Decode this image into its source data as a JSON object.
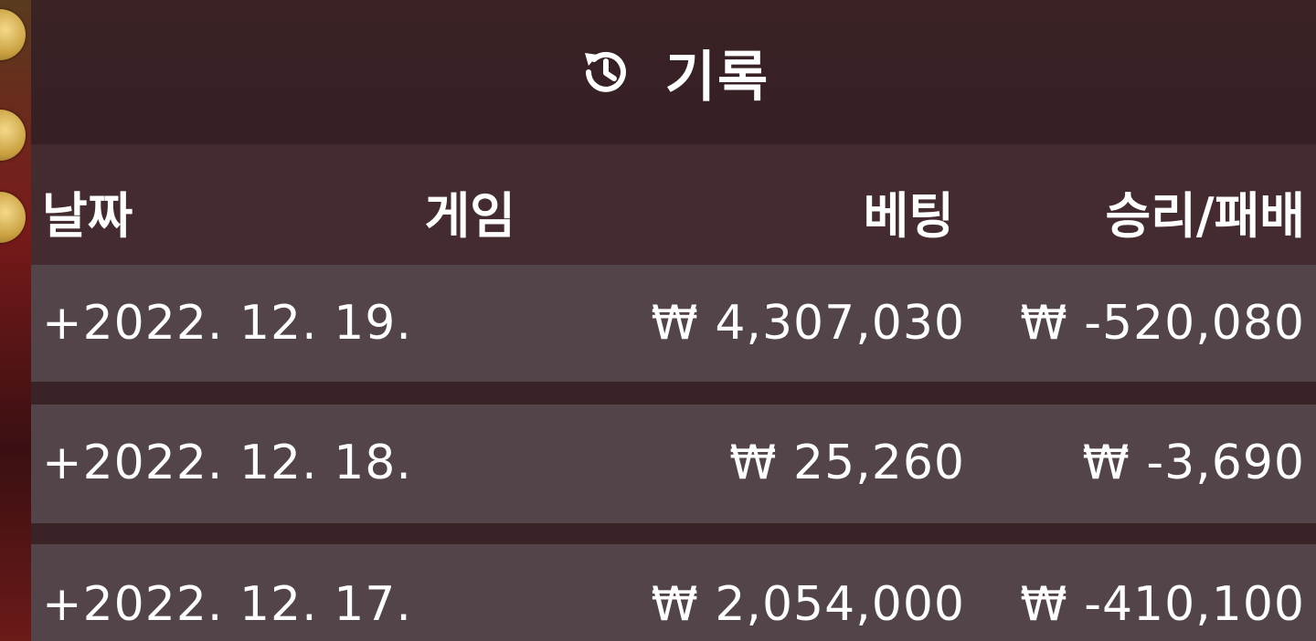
{
  "title": {
    "icon": "history-icon",
    "text": "기록"
  },
  "columns": {
    "date": "날짜",
    "game": "게임",
    "bet": "베팅",
    "result": "승리/패배"
  },
  "rows": [
    {
      "date": "+2022. 12. 19.",
      "game": "",
      "bet": "₩ 4,307,030",
      "result": "₩ -520,080"
    },
    {
      "date": "+2022. 12. 18.",
      "game": "",
      "bet": "₩ 25,260",
      "result": "₩ -3,690"
    },
    {
      "date": "+2022. 12. 17.",
      "game": "",
      "bet": "₩ 2,054,000",
      "result": "₩ -410,100"
    }
  ]
}
